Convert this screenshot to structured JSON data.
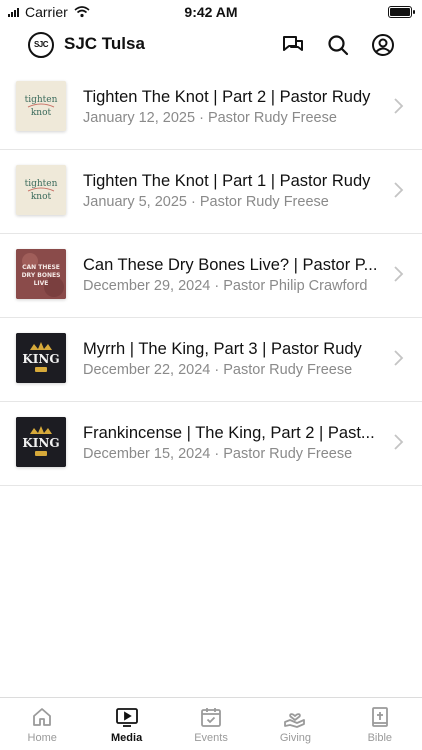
{
  "status_bar": {
    "carrier": "Carrier",
    "time": "9:42 AM"
  },
  "header": {
    "logo_text": "SJC",
    "title": "SJC Tulsa"
  },
  "media_list": [
    {
      "title": "Tighten The Knot | Part 2 | Pastor Rudy",
      "subtitle": "January 12, 2025 · Pastor Rudy Freese",
      "thumb_text": "tighten knot",
      "thumb_style": "knot"
    },
    {
      "title": "Tighten The Knot | Part 1 | Pastor Rudy",
      "subtitle": "January 5, 2025 · Pastor Rudy Freese",
      "thumb_text": "tighten knot",
      "thumb_style": "knot"
    },
    {
      "title": "Can These Dry Bones Live? | Pastor P...",
      "subtitle": "December 29, 2024 · Pastor Philip Crawford",
      "thumb_text": "CAN THESE DRY BONES LIVE",
      "thumb_style": "bones"
    },
    {
      "title": "Myrrh | The King, Part 3 | Pastor Rudy",
      "subtitle": "December 22, 2024 · Pastor Rudy Freese",
      "thumb_text": "KING",
      "thumb_style": "king"
    },
    {
      "title": "Frankincense | The King, Part 2 | Past...",
      "subtitle": "December 15, 2024 · Pastor Rudy Freese",
      "thumb_text": "KING",
      "thumb_style": "king"
    }
  ],
  "tabs": [
    {
      "label": "Home",
      "icon": "home-icon",
      "active": false
    },
    {
      "label": "Media",
      "icon": "media-icon",
      "active": true
    },
    {
      "label": "Events",
      "icon": "events-icon",
      "active": false
    },
    {
      "label": "Giving",
      "icon": "giving-icon",
      "active": false
    },
    {
      "label": "Bible",
      "icon": "bible-icon",
      "active": false
    }
  ],
  "colors": {
    "active": "#111111",
    "inactive": "#9a9a9a",
    "subtitle": "#8a8a8a",
    "divider": "#e6e6e6"
  }
}
